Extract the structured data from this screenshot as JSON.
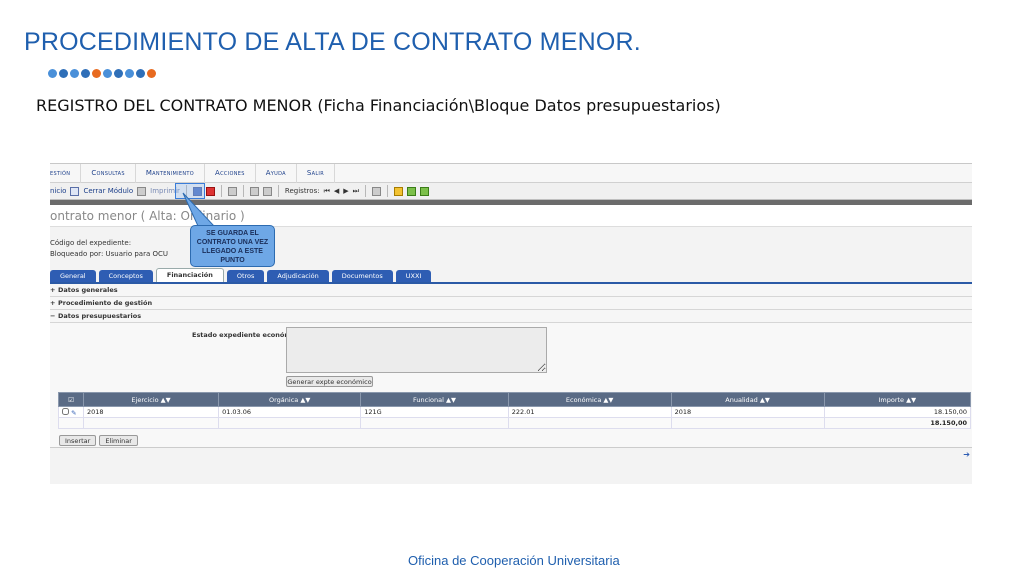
{
  "slide": {
    "title": "PROCEDIMIENTO DE ALTA DE CONTRATO MENOR.",
    "subtitle": "REGISTRO DEL CONTRATO MENOR (Ficha Financiación\\Bloque Datos presupuestarios)",
    "footer": "Oficina de Cooperación Universitaria",
    "dot_colors": [
      "#4a90d9",
      "#2f6fb8",
      "#4a90d9",
      "#2f6fb8",
      "#e86a1f",
      "#4a90d9",
      "#2f6fb8",
      "#4a90d9",
      "#2f6fb8",
      "#e86a1f"
    ]
  },
  "menu": [
    "estión",
    "Consultas",
    "Mantenimiento",
    "Acciones",
    "Ayuda",
    "Salir"
  ],
  "toolbar": {
    "inicio": "nicio",
    "cerrar": "Cerrar Módulo",
    "imprimir": "Imprimir",
    "registros": "Registros:"
  },
  "form": {
    "title": "ontrato menor ( Alta: Ordinario )",
    "codigo_label": "Código del expediente:",
    "bloqueado": "Bloqueado por: Usuario para OCU"
  },
  "tabs": [
    "General",
    "Conceptos",
    "Financiación",
    "Otros",
    "Adjudicación",
    "Documentos",
    "UXXI"
  ],
  "active_tab": "Financiación",
  "sections": {
    "datos_generales": "Datos generales",
    "procedimiento": "Procedimiento de gestión",
    "presupuestarios": "Datos presupuestarios"
  },
  "budget": {
    "estado_label": "Estado expediente económico:",
    "generar_btn": "Generar expte económico",
    "columns": [
      "Ejercicio ▲▼",
      "Orgánica ▲▼",
      "Funcional ▲▼",
      "Económica ▲▼",
      "Anualidad ▲▼",
      "Importe ▲▼"
    ],
    "rows": [
      {
        "ejercicio": "2018",
        "organica": "01.03.06",
        "funcional": "121G",
        "economica": "222.01",
        "anualidad": "2018",
        "importe": "18.150,00"
      }
    ],
    "total": "18.150,00",
    "insertar": "Insertar",
    "eliminar": "Eliminar"
  },
  "callout": {
    "text": "SE GUARDA EL CONTRATO UNA VEZ LLEGADO A ESTE PUNTO"
  }
}
